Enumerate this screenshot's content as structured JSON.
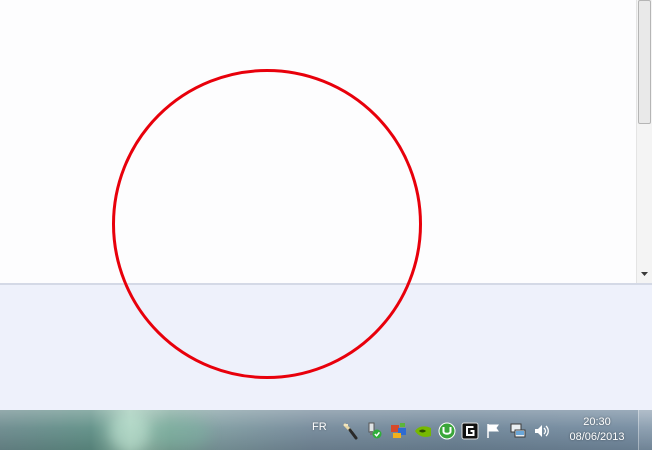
{
  "taskbar": {
    "language": "FR",
    "tray_icons": [
      "pen-tablet-icon",
      "safely-remove-hardware-icon",
      "network-adapter-icon",
      "nvidia-icon",
      "utorrent-icon",
      "g-app-icon",
      "action-center-flag-icon",
      "network-icon",
      "volume-icon"
    ],
    "clock": {
      "time": "20:30",
      "date": "08/06/2013"
    }
  },
  "colors": {
    "annotation_circle": "#e8000b",
    "lower_panel": "#eef1fb",
    "window_bg": "#fdfdfe"
  }
}
